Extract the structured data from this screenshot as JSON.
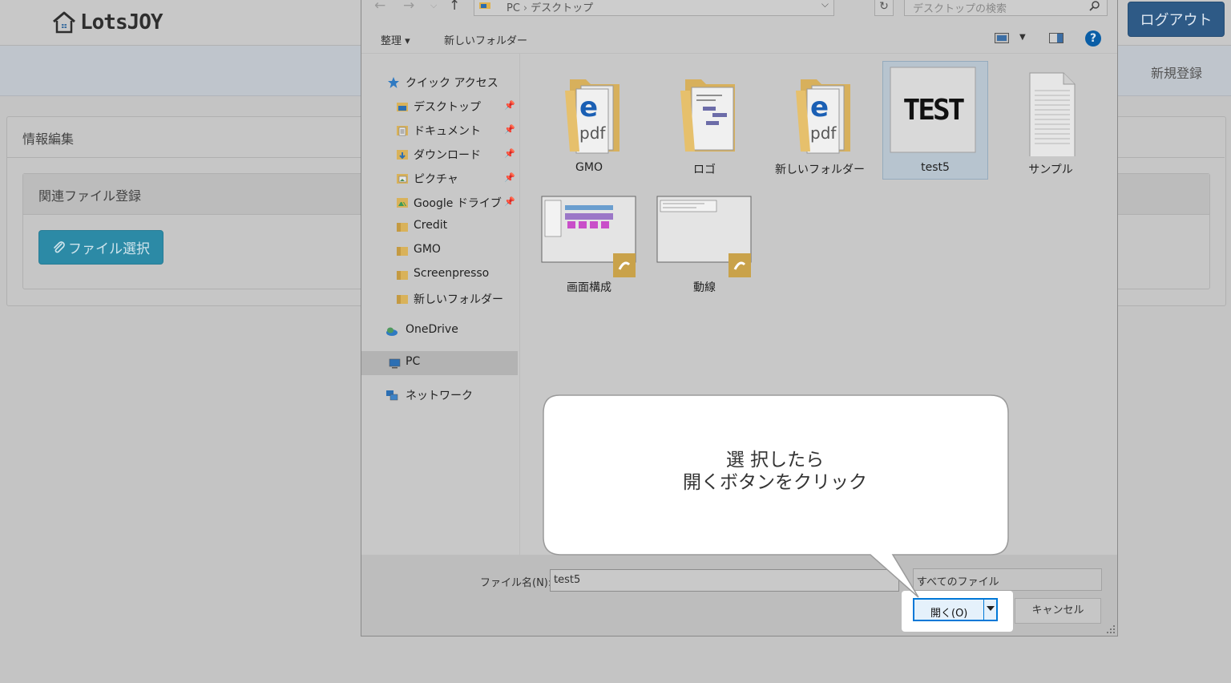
{
  "app": {
    "logo_text": "LotsJOY",
    "logout_label": "ログアウト",
    "register_label": "新規登録",
    "panel_title": "情報編集",
    "subpanel_title": "関連ファイル登録",
    "file_select_label": "ファイル選択"
  },
  "dialog": {
    "breadcrumb": [
      "PC",
      "デスクトップ"
    ],
    "search_placeholder": "デスクトップの検索",
    "toolbar": {
      "organize_label": "整理 ▾",
      "new_folder_label": "新しいフォルダー"
    },
    "help_label": "?",
    "nav": {
      "quick_access": "クイック アクセス",
      "desktop": "デスクトップ",
      "documents": "ドキュメント",
      "downloads": "ダウンロード",
      "pictures": "ピクチャ",
      "google_drive": "Google ドライブ",
      "credit": "Credit",
      "gmo": "GMO",
      "screenpresso": "Screenpresso",
      "new_folder": "新しいフォルダー",
      "onedrive": "OneDrive",
      "pc": "PC",
      "network": "ネットワーク",
      "selected": "PC"
    },
    "files": {
      "f1": "GMO",
      "f2": "ロゴ",
      "f3": "新しいフォルダー",
      "f4": "test5",
      "f4_thumb": "TEST",
      "f5": "サンプル",
      "f6": "画面構成",
      "f7": "動線",
      "selected": "test5"
    },
    "footer": {
      "filename_label": "ファイル名(N):",
      "filename_value": "test5",
      "filetype_value": "すべてのファイル",
      "open_label": "開く(O)",
      "cancel_label": "キャンセル"
    }
  },
  "callout": {
    "line1": "選 択したら",
    "line2": "開くボタンをクリック"
  },
  "colors": {
    "accent_blue": "#0078d7",
    "logout_bg": "#2e5a86",
    "file_button_bg": "#2c8aa6",
    "help_icon": "#0a5ea6"
  }
}
